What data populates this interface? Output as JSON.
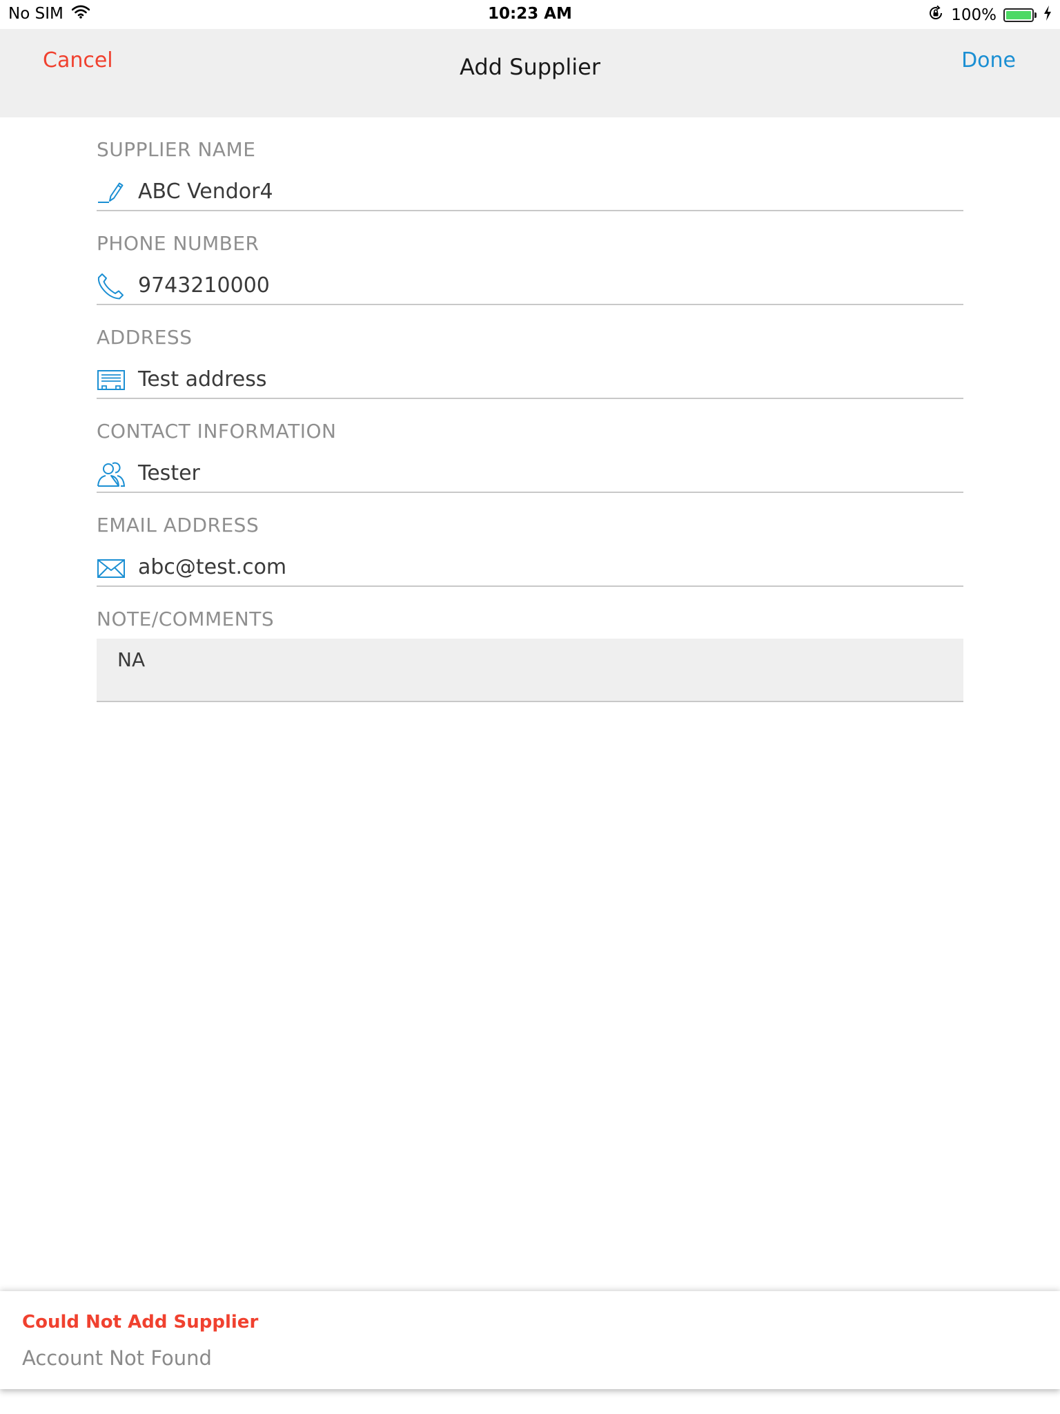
{
  "status_bar": {
    "carrier": "No SIM",
    "time": "10:23 AM",
    "battery": "100%",
    "battery_level": 1.0
  },
  "nav": {
    "cancel_label": "Cancel",
    "title": "Add Supplier",
    "done_label": "Done"
  },
  "form": {
    "fields": [
      {
        "label": "SUPPLIER NAME",
        "value": "ABC Vendor4",
        "icon": "pencil-icon"
      },
      {
        "label": "PHONE NUMBER",
        "value": "9743210000",
        "icon": "phone-icon"
      },
      {
        "label": "ADDRESS",
        "value": "Test address",
        "icon": "address-card-icon"
      },
      {
        "label": "CONTACT INFORMATION",
        "value": "Tester",
        "icon": "contacts-icon"
      },
      {
        "label": "EMAIL ADDRESS",
        "value": "abc@test.com",
        "icon": "envelope-icon"
      }
    ],
    "note": {
      "label": "NOTE/COMMENTS",
      "value": "NA"
    }
  },
  "toast": {
    "title": "Could Not Add Supplier",
    "message": "Account Not Found"
  },
  "colors": {
    "accent": "#1b8fd3",
    "destructive": "#f0412f",
    "nav_background": "#efefef",
    "battery_green": "#4cd964"
  }
}
